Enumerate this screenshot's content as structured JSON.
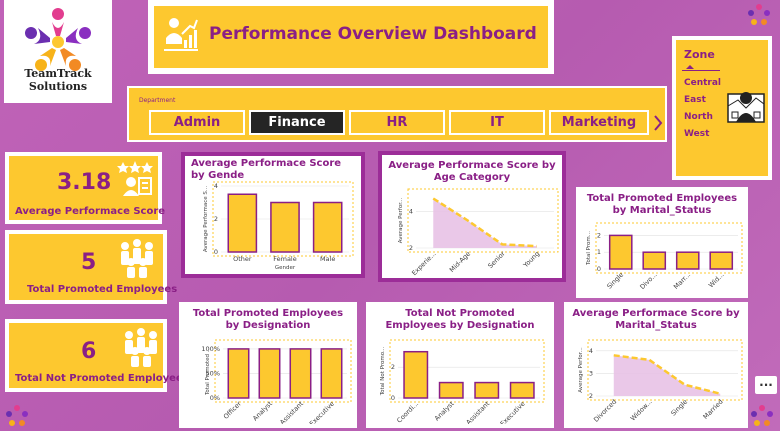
{
  "brand": {
    "name": "TeamTrack Solutions"
  },
  "header": {
    "title": "Performance Overview Dashboard"
  },
  "zone": {
    "title": "Zone",
    "items": [
      "Central",
      "East",
      "North",
      "West"
    ]
  },
  "department": {
    "label": "Department",
    "tabs": [
      "Admin",
      "Finance",
      "HR",
      "IT",
      "Marketing"
    ],
    "selected": "Finance",
    "next_icon": "chevron-right-icon"
  },
  "kpis": [
    {
      "value": "3.18",
      "label": "Average Performace Score",
      "icon": "award-icon"
    },
    {
      "value": "5",
      "label": "Total Promoted Employees",
      "icon": "people-group-icon"
    },
    {
      "value": "6",
      "label": "Total Not Promoted Employees",
      "icon": "people-group-icon"
    }
  ],
  "colors": {
    "bar": "#fdc82f",
    "bar_stroke": "#8a1f86",
    "area": "#e8c2e6",
    "accent": "#8a1f86"
  },
  "chart_data": [
    {
      "id": "gender",
      "type": "bar",
      "title": "Average Performace Score by Gende",
      "ylabel": "Average Performace S...",
      "xlabel": "Gender",
      "categories": [
        "Other",
        "Female",
        "Male"
      ],
      "values": [
        3.5,
        3.0,
        3.0
      ],
      "ylim": [
        0,
        4
      ],
      "yticks": [
        "0",
        "2",
        "4"
      ]
    },
    {
      "id": "age",
      "type": "area",
      "title": "Average Performace Score by Age Category",
      "ylabel": "Average Perfor...",
      "xlabel": "",
      "categories": [
        "Experie...",
        "Mid-Age",
        "Senior",
        "Young"
      ],
      "values": [
        4.7,
        3.5,
        2.2,
        2.1
      ],
      "ylim": [
        2,
        5
      ],
      "yticks": [
        "2",
        "4"
      ]
    },
    {
      "id": "marital_promoted",
      "type": "bar",
      "title": "Total Promoted Employees by Marital_Status",
      "ylabel": "Total Prom...",
      "xlabel": "",
      "categories": [
        "Single",
        "Divo...",
        "Marr...",
        "Wid..."
      ],
      "values": [
        2,
        1,
        1,
        1
      ],
      "ylim": [
        0,
        2.5
      ],
      "yticks": [
        "0",
        "1",
        "2"
      ]
    },
    {
      "id": "designation_promoted",
      "type": "bar",
      "title": "Total Promoted Employees by Designation",
      "ylabel": "Total Promoted ...",
      "xlabel": "",
      "categories": [
        "Officer",
        "Analyst",
        "Assistant",
        "Executive"
      ],
      "values": [
        100,
        100,
        100,
        100
      ],
      "ylim": [
        0,
        110
      ],
      "yticks": [
        "0%",
        "50%",
        "100%"
      ]
    },
    {
      "id": "designation_not_promoted",
      "type": "bar",
      "title": "Total Not Promoted Employees by Designation",
      "ylabel": "Total Not Promo...",
      "xlabel": "",
      "categories": [
        "Coordi...",
        "Analyst",
        "Assistant",
        "Executive"
      ],
      "values": [
        3,
        1,
        1,
        1
      ],
      "ylim": [
        0,
        3.5
      ],
      "yticks": [
        "0",
        "2"
      ]
    },
    {
      "id": "marital_score",
      "type": "area",
      "title": "Average Performace Score by Marital_Status",
      "ylabel": "Average Perfor...",
      "xlabel": "",
      "categories": [
        "Divorced",
        "Widow...",
        "Single",
        "Married"
      ],
      "values": [
        3.8,
        3.6,
        2.5,
        2.1
      ],
      "ylim": [
        2,
        4.3
      ],
      "yticks": [
        "2",
        "3",
        "4"
      ]
    }
  ],
  "more_options": "..."
}
